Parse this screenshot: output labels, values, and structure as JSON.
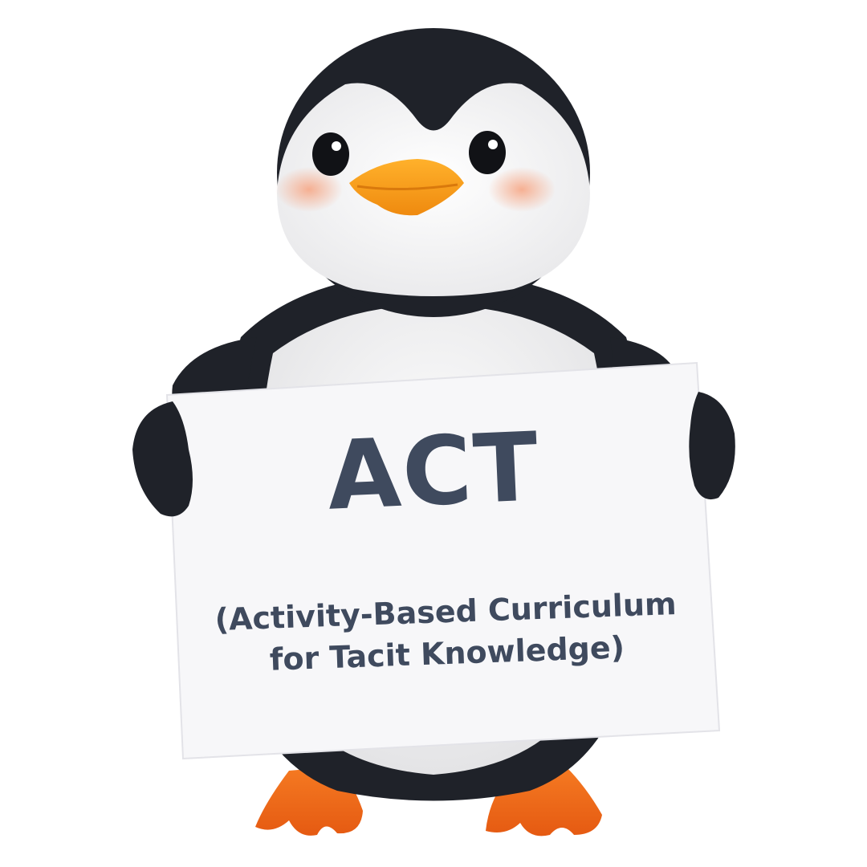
{
  "sign": {
    "title": "ACT",
    "subtitle_line1": "(Activity-Based Curriculum",
    "subtitle_line2": "for Tacit Knowledge)"
  },
  "colors": {
    "background": "#ffffff",
    "penguin_black": "#1f2229",
    "penguin_white": "#f4f4f4",
    "beak_orange": "#f39a1c",
    "feet_orange": "#f26a1b",
    "sign_paper": "#f7f7f9",
    "sign_text": "#3f4a5e"
  }
}
